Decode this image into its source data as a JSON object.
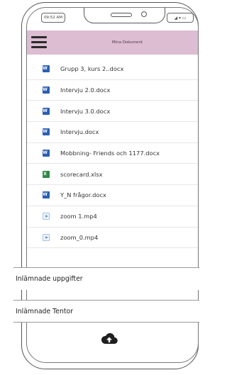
{
  "status": {
    "time": "09:52 AM",
    "icons": "◢ ▾ ▭"
  },
  "header": {
    "title": "Mina Dokument"
  },
  "files": [
    {
      "name": "Grupp 3, kurs 2..docx",
      "type": "docx"
    },
    {
      "name": "Intervju 2.0.docx",
      "type": "docx"
    },
    {
      "name": "Intervju 3.0.docx",
      "type": "docx"
    },
    {
      "name": "Intervju.docx",
      "type": "docx"
    },
    {
      "name": "Mobbning- Friends och 1177.docx",
      "type": "docx"
    },
    {
      "name": "scorecard.xlsx",
      "type": "xlsx"
    },
    {
      "name": "Y_N frågor.docx",
      "type": "docx"
    },
    {
      "name": "zoom 1.mp4",
      "type": "mp4"
    },
    {
      "name": "zoom_0.mp4",
      "type": "mp4"
    }
  ],
  "sections": {
    "uppgifter": "Inlämnade uppgifter",
    "tentor": "Inlämnade Tentor"
  },
  "icons": {
    "menu": "hamburger-menu-icon",
    "upload": "cloud-upload-icon"
  }
}
